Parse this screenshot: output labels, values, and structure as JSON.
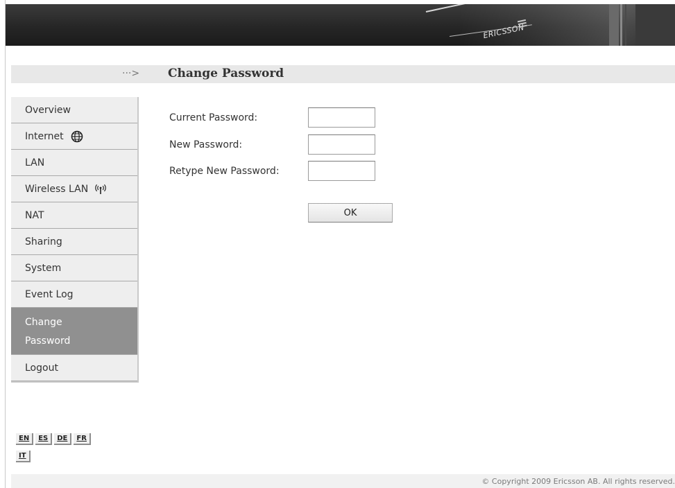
{
  "header": {
    "logo_text": "ERICSSON",
    "logo": "ericsson-logo"
  },
  "title_bar": {
    "arrow_glyph": "···>",
    "title": "Change Password"
  },
  "sidebar": {
    "items": [
      {
        "label": "Overview",
        "icon": null,
        "active": false
      },
      {
        "label": "Internet",
        "icon": "globe-icon",
        "active": false
      },
      {
        "label": "LAN",
        "icon": null,
        "active": false
      },
      {
        "label": "Wireless LAN",
        "icon": "wireless-antenna-icon",
        "active": false
      },
      {
        "label": "NAT",
        "icon": null,
        "active": false
      },
      {
        "label": "Sharing",
        "icon": null,
        "active": false
      },
      {
        "label": "System",
        "icon": null,
        "active": false
      },
      {
        "label": "Event Log",
        "icon": null,
        "active": false
      },
      {
        "label": "Change\nPassword",
        "icon": null,
        "active": true
      },
      {
        "label": "Logout",
        "icon": null,
        "active": false
      }
    ]
  },
  "form": {
    "current_password_label": "Current Password:",
    "current_password_value": "",
    "new_password_label": "New Password:",
    "new_password_value": "",
    "retype_password_label": "Retype New Password:",
    "retype_password_value": "",
    "ok_label": "OK"
  },
  "languages": [
    "EN",
    "ES",
    "DE",
    "FR",
    "IT"
  ],
  "footer": {
    "copyright": "© Copyright 2009 Ericsson AB. All rights reserved."
  },
  "colors": {
    "header_bg": "#262626",
    "nav_bg": "#eeeeee",
    "nav_active_bg": "#909090",
    "title_bar_bg": "#e8e8e8"
  }
}
